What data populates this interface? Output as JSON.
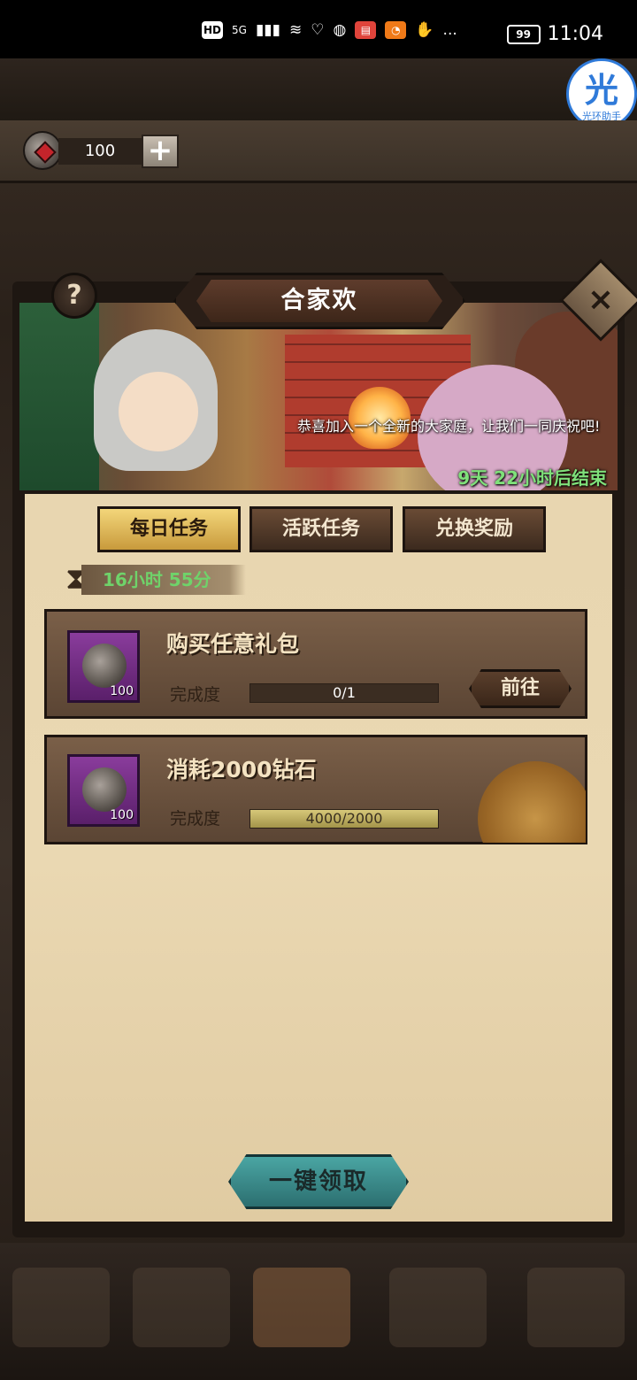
{
  "status_bar": {
    "icons": [
      "HD",
      "5G",
      "signal",
      "wifi",
      "heart",
      "ball",
      "book-app",
      "chat-app",
      "hand",
      "..."
    ],
    "battery": "99",
    "time": "11:04"
  },
  "assistant": {
    "glyph": "光",
    "label": "光环助手"
  },
  "currency": {
    "icon": "gem-icon",
    "count": "100",
    "add_label": "+"
  },
  "panel": {
    "title": "合家欢",
    "help_label": "?",
    "close_label": "×",
    "banner_description": "恭喜加入一个全新的大家庭，让我们一同庆祝吧!",
    "banner_countdown": "9天 22小时后结束"
  },
  "tabs": [
    {
      "label": "每日任务",
      "active": true
    },
    {
      "label": "活跃任务",
      "active": false
    },
    {
      "label": "兑换奖励",
      "active": false
    }
  ],
  "timer": {
    "icon": "hourglass-icon",
    "text": "16小时 55分"
  },
  "tasks": [
    {
      "title": "购买任意礼包",
      "reward_count": "100",
      "progress_label": "完成度",
      "progress_text": "0/1",
      "progress_fraction": 0,
      "action_label": "前往"
    },
    {
      "title": "消耗2000钻石",
      "reward_count": "100",
      "progress_label": "完成度",
      "progress_text": "4000/2000",
      "progress_fraction": 1,
      "completed_stamp": true
    }
  ],
  "claim_all_label": "一键领取",
  "colors": {
    "timer_text": "#6fd36a",
    "countdown_text": "#7fe07a",
    "claim_button": "#3a8b8a",
    "active_tab": "#e2b85a"
  }
}
